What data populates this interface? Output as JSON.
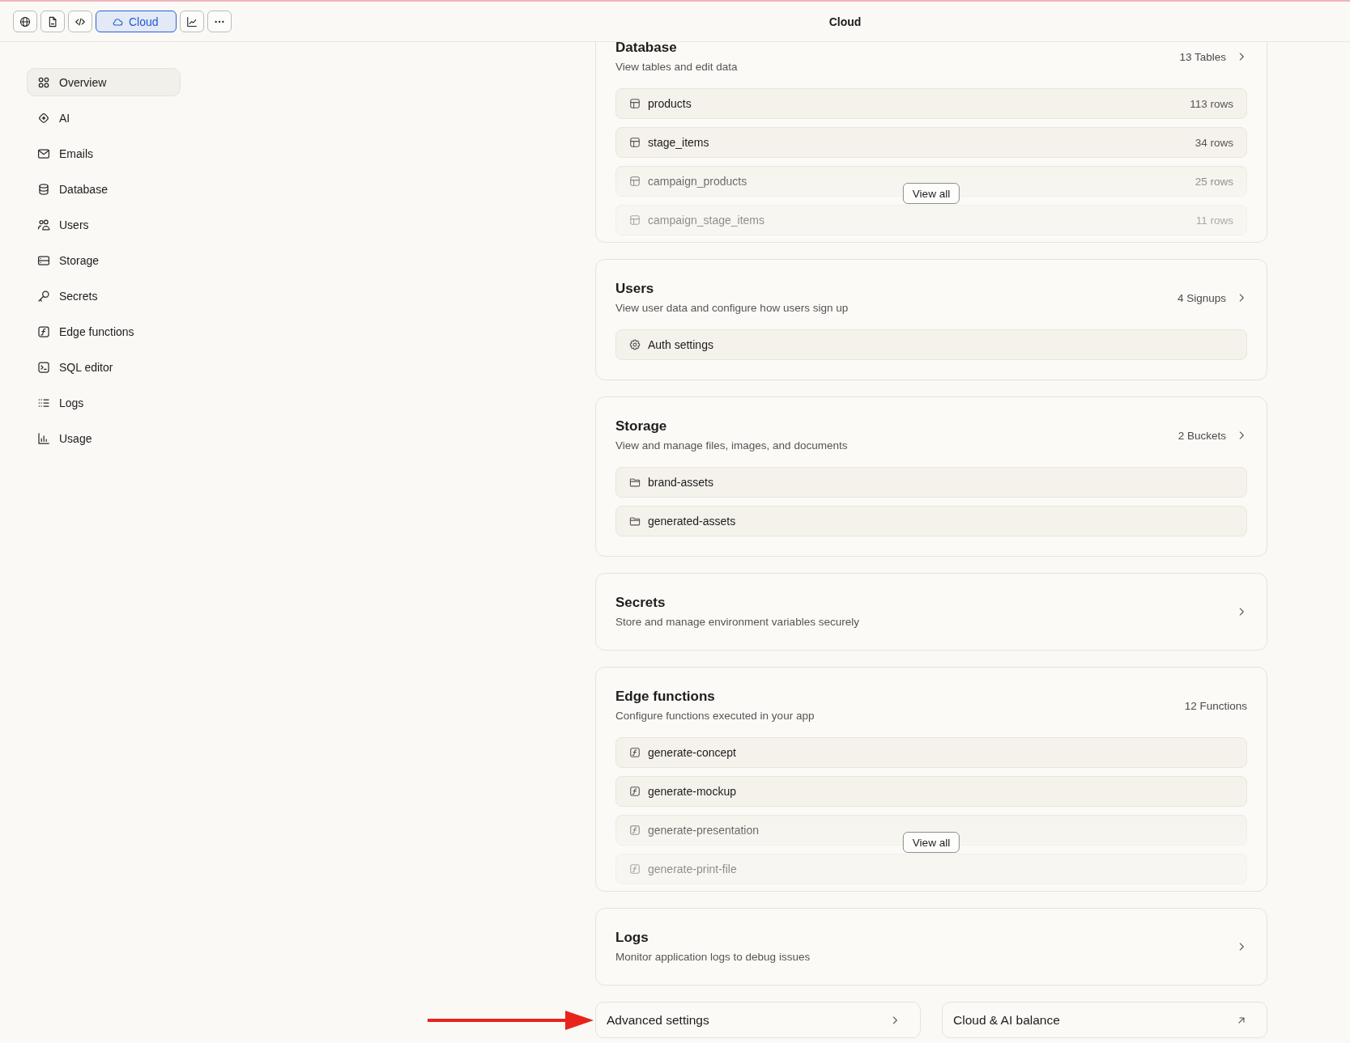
{
  "header": {
    "toolbar": [
      {
        "selected": false
      },
      {
        "selected": false
      },
      {
        "selected": false
      },
      {
        "label": "Cloud",
        "selected": true
      },
      {
        "selected": false
      },
      {
        "selected": false
      }
    ],
    "title": "Cloud"
  },
  "sidebar": {
    "items": [
      {
        "label": "Overview",
        "selected": true
      },
      {
        "label": "AI",
        "selected": false
      },
      {
        "label": "Emails",
        "selected": false
      },
      {
        "label": "Database",
        "selected": false
      },
      {
        "label": "Users",
        "selected": false
      },
      {
        "label": "Storage",
        "selected": false
      },
      {
        "label": "Secrets",
        "selected": false
      },
      {
        "label": "Edge functions",
        "selected": false
      },
      {
        "label": "SQL editor",
        "selected": false
      },
      {
        "label": "Logs",
        "selected": false
      },
      {
        "label": "Usage",
        "selected": false
      }
    ]
  },
  "cards": [
    {
      "title": "Database",
      "description": "View tables and edit data",
      "count": "13 Tables",
      "chevron": true,
      "rows": [
        {
          "kind": "table",
          "name": "products",
          "count": "113 rows"
        },
        {
          "kind": "table",
          "name": "stage_items",
          "count": "34 rows"
        },
        {
          "kind": "table",
          "name": "campaign_products",
          "count": "25 rows"
        },
        {
          "kind": "table",
          "name": "campaign_stage_items",
          "count": "11 rows"
        }
      ],
      "view_all": "View all"
    },
    {
      "title": "Users",
      "description": "View user data and configure how users sign up",
      "count": "4 Signups",
      "chevron": true,
      "rows": [
        {
          "kind": "setting",
          "name": "Auth settings"
        }
      ]
    },
    {
      "title": "Storage",
      "description": "View and manage files, images, and documents",
      "count": "2 Buckets",
      "chevron": true,
      "rows": [
        {
          "kind": "bucket",
          "name": "brand-assets"
        },
        {
          "kind": "bucket",
          "name": "generated-assets"
        }
      ]
    },
    {
      "title": "Secrets",
      "description": "Store and manage environment variables securely",
      "chevron": true
    },
    {
      "title": "Edge functions",
      "description": "Configure functions executed in your app",
      "count": "12 Functions",
      "chevron": false,
      "rows": [
        {
          "kind": "function",
          "name": "generate-concept"
        },
        {
          "kind": "function",
          "name": "generate-mockup"
        },
        {
          "kind": "function",
          "name": "generate-presentation"
        },
        {
          "kind": "function",
          "name": "generate-print-file"
        }
      ],
      "view_all": "View all"
    },
    {
      "title": "Logs",
      "description": "Monitor application logs to debug issues",
      "chevron": true
    }
  ],
  "footer_links": [
    {
      "label": "Advanced settings",
      "kind": "internal"
    },
    {
      "label": "Cloud & AI balance",
      "kind": "external"
    }
  ]
}
